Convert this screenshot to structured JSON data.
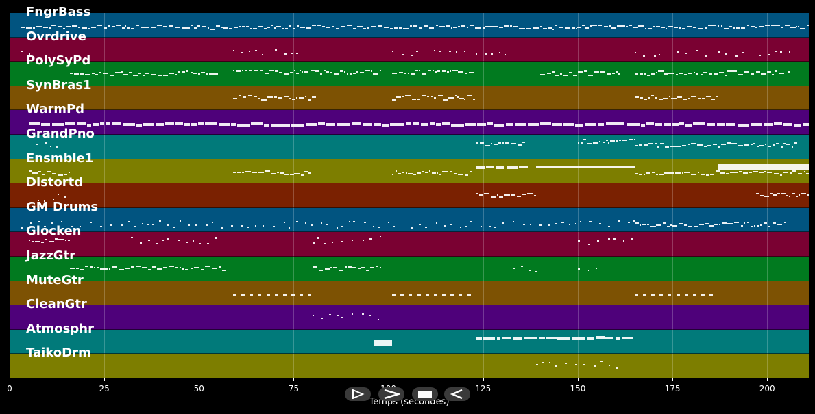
{
  "chart_data": {
    "type": "piano-roll",
    "xlabel": "Temps (secondes)",
    "xlim": [
      0,
      211
    ],
    "xticks": [
      0,
      25,
      50,
      75,
      100,
      125,
      150,
      175,
      200
    ],
    "tracks": [
      {
        "name": "FngrBass",
        "color": "#015480",
        "segments": [
          [
            3,
            211,
            0.55,
            "dense"
          ]
        ]
      },
      {
        "name": "Ovrdrive",
        "color": "#7a0132",
        "segments": [
          [
            3,
            7,
            0.55,
            "sparse"
          ],
          [
            59,
            67,
            0.6,
            "sparse"
          ],
          [
            70,
            78,
            0.6,
            "sparse"
          ],
          [
            101,
            109,
            0.6,
            "sparse"
          ],
          [
            112,
            120,
            0.6,
            "sparse"
          ],
          [
            123,
            131,
            0.6,
            "sparse"
          ],
          [
            165,
            173,
            0.6,
            "sparse"
          ],
          [
            176,
            184,
            0.6,
            "sparse"
          ],
          [
            187,
            195,
            0.6,
            "sparse"
          ],
          [
            198,
            206,
            0.6,
            "sparse"
          ]
        ]
      },
      {
        "name": "PolySyPd",
        "color": "#017a1f",
        "segments": [
          [
            16,
            55,
            0.45,
            "dense"
          ],
          [
            59,
            98,
            0.4,
            "dense"
          ],
          [
            101,
            123,
            0.4,
            "dense"
          ],
          [
            140,
            161,
            0.45,
            "dense"
          ],
          [
            165,
            206,
            0.45,
            "dense"
          ]
        ]
      },
      {
        "name": "SynBras1",
        "color": "#7d5203",
        "segments": [
          [
            59,
            81,
            0.45,
            "dense"
          ],
          [
            101,
            123,
            0.45,
            "dense"
          ],
          [
            165,
            187,
            0.45,
            "dense"
          ]
        ]
      },
      {
        "name": "WarmPd",
        "color": "#4e017a",
        "segments": [
          [
            5,
            211,
            0.52,
            "thick"
          ]
        ]
      },
      {
        "name": "GrandPno",
        "color": "#017a7a",
        "segments": [
          [
            7,
            14,
            0.4,
            "sparse"
          ],
          [
            123,
            136,
            0.35,
            "dense"
          ],
          [
            150,
            165,
            0.25,
            "dense"
          ],
          [
            165,
            208,
            0.4,
            "dense"
          ]
        ]
      },
      {
        "name": "Ensmble1",
        "color": "#7d7e00",
        "segments": [
          [
            5,
            16,
            0.55,
            "dense"
          ],
          [
            59,
            80,
            0.55,
            "dense"
          ],
          [
            101,
            122,
            0.55,
            "dense"
          ],
          [
            123,
            137,
            0.28,
            "thick"
          ],
          [
            139,
            165,
            0.28,
            "line"
          ],
          [
            165,
            211,
            0.55,
            "dense"
          ],
          [
            187,
            211,
            0.28,
            "block"
          ]
        ]
      },
      {
        "name": "Distortd",
        "color": "#7a2101",
        "segments": [
          [
            5,
            16,
            0.55,
            "sparse"
          ],
          [
            123,
            139,
            0.45,
            "dense"
          ],
          [
            197,
            211,
            0.45,
            "dense"
          ]
        ]
      },
      {
        "name": "GM Drums",
        "color": "#015480",
        "segments": [
          [
            3,
            166,
            0.65,
            "sparse"
          ],
          [
            165,
            205,
            0.65,
            "dense"
          ]
        ]
      },
      {
        "name": "Glocken",
        "color": "#7a0132",
        "segments": [
          [
            5,
            16,
            0.3,
            "dense"
          ],
          [
            32,
            56,
            0.3,
            "sparse"
          ],
          [
            80,
            98,
            0.3,
            "sparse"
          ],
          [
            150,
            165,
            0.35,
            "sparse"
          ]
        ]
      },
      {
        "name": "JazzGtr",
        "color": "#017a1f",
        "segments": [
          [
            16,
            57,
            0.45,
            "dense"
          ],
          [
            80,
            98,
            0.45,
            "dense"
          ],
          [
            133,
            141,
            0.45,
            "sparse"
          ],
          [
            150,
            155,
            0.45,
            "sparse"
          ]
        ]
      },
      {
        "name": "MuteGtr",
        "color": "#7d5203",
        "segments": [
          [
            59,
            80,
            0.55,
            "dash"
          ],
          [
            101,
            122,
            0.55,
            "dash"
          ],
          [
            165,
            186,
            0.55,
            "dash"
          ]
        ]
      },
      {
        "name": "CleanGtr",
        "color": "#4e017a",
        "segments": [
          [
            80,
            98,
            0.45,
            "sparse"
          ]
        ]
      },
      {
        "name": "Atmosphr",
        "color": "#017a7a",
        "segments": [
          [
            96,
            101,
            0.5,
            "block"
          ],
          [
            123,
            165,
            0.3,
            "thick"
          ]
        ]
      },
      {
        "name": "TaikoDrm",
        "color": "#7d7e00",
        "segments": [
          [
            139,
            162,
            0.4,
            "sparse"
          ]
        ]
      }
    ]
  },
  "controls": [
    {
      "name": "rewind",
      "icon": "step-back-icon"
    },
    {
      "name": "forward",
      "icon": "play-forward-icon"
    },
    {
      "name": "stop",
      "icon": "stop-icon"
    },
    {
      "name": "back",
      "icon": "play-back-icon"
    }
  ]
}
